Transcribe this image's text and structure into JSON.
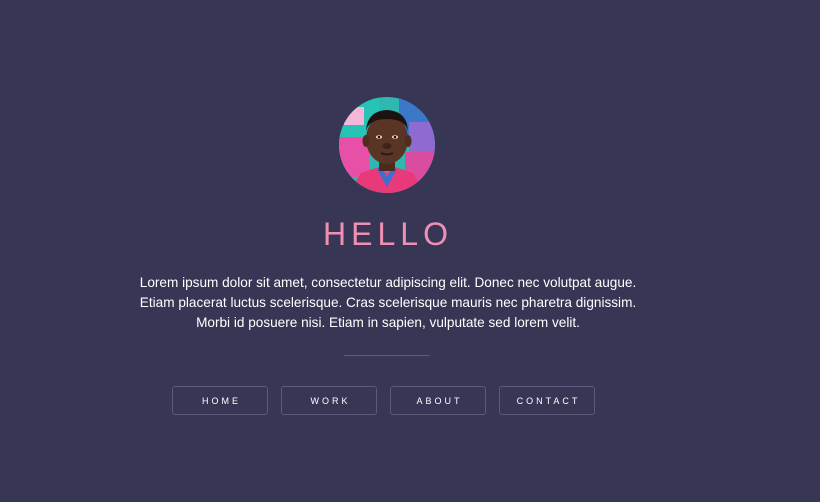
{
  "profile": {
    "avatar_icon": "person-portrait",
    "title": "HELLO",
    "bio": "Lorem ipsum dolor sit amet, consectetur adipiscing elit. Donec nec volutpat augue. Etiam placerat luctus scelerisque. Cras scelerisque mauris nec pharetra dignissim. Morbi id posuere nisi. Etiam in sapien, vulputate sed lorem velit."
  },
  "nav": {
    "items": [
      {
        "label": "HOME"
      },
      {
        "label": "WORK"
      },
      {
        "label": "ABOUT"
      },
      {
        "label": "CONTACT"
      }
    ]
  },
  "colors": {
    "background": "#383655",
    "accent": "#f08fb4",
    "text": "#ffffff",
    "border": "#5c5a78"
  }
}
